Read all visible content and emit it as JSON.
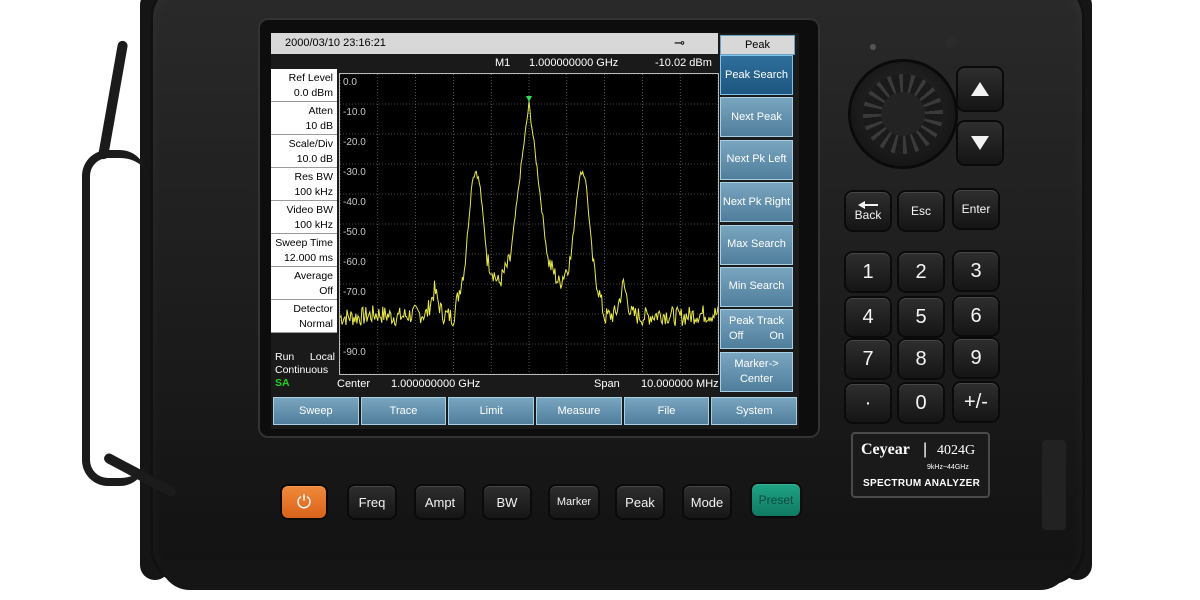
{
  "status_bar": {
    "datetime": "2000/03/10  23:16:21",
    "power_icon": "plug-icon"
  },
  "menu_title": "Peak",
  "marker": {
    "name": "M1",
    "frequency": "1.000000000 GHz",
    "amplitude": "-10.02 dBm"
  },
  "params": [
    {
      "label": "Ref Level",
      "value": "0.0 dBm"
    },
    {
      "label": "Atten",
      "value": "10 dB"
    },
    {
      "label": "Scale/Div",
      "value": "10.0 dB"
    },
    {
      "label": "Res BW",
      "value": "100 kHz"
    },
    {
      "label": "Video BW",
      "value": "100 kHz"
    },
    {
      "label": "Sweep Time",
      "value": "12.000 ms"
    },
    {
      "label": "Average",
      "value": "Off"
    },
    {
      "label": "Detector",
      "value": "Normal"
    }
  ],
  "mode_status": {
    "run": "Run",
    "local": "Local",
    "continuous": "Continuous",
    "mode": "SA"
  },
  "y_ticks": [
    "0.0",
    "-10.0",
    "-20.0",
    "-30.0",
    "-40.0",
    "-50.0",
    "-60.0",
    "-70.0",
    "",
    "-90.0"
  ],
  "footer": {
    "center_label": "Center",
    "center_value": "1.000000000 GHz",
    "span_label": "Span",
    "span_value": "10.000000 MHz"
  },
  "softkeys": {
    "peak_search": "Peak Search",
    "next_peak": "Next Peak",
    "next_pk_left": "Next Pk Left",
    "next_pk_right": "Next Pk Right",
    "max_search": "Max Search",
    "min_search": "Min Search",
    "peak_track": "Peak Track",
    "peak_track_off": "Off",
    "peak_track_on": "On",
    "marker_to": "Marker->",
    "marker_to_center": "Center"
  },
  "bottom_menu": [
    "Sweep",
    "Trace",
    "Limit",
    "Measure",
    "File",
    "System"
  ],
  "hard_keys": {
    "power": "⏻",
    "freq": "Freq",
    "ampt": "Ampt",
    "bw": "BW",
    "marker": "Marker",
    "peak": "Peak",
    "mode": "Mode",
    "preset": "Preset"
  },
  "keypad": {
    "back": "Back",
    "esc": "Esc",
    "enter": "Enter",
    "digits": [
      "1",
      "2",
      "3",
      "4",
      "5",
      "6",
      "7",
      "8",
      "9"
    ],
    "dot": "·",
    "zero": "0",
    "sign": "+/-"
  },
  "brand": {
    "logo": "Ceyear",
    "model": "4024G",
    "range": "9kHz~44GHz",
    "name": "SPECTRUM  ANALYZER"
  },
  "colors": {
    "trace": "#e8e84a",
    "softkey": "#5f8fae",
    "softkey_active": "#2a6a96",
    "power_button": "#e8741f",
    "preset_button": "#17907a",
    "mode_sa": "#1fd11f"
  },
  "chart_data": {
    "type": "line",
    "xlabel": "",
    "ylabel": "",
    "x_unit": "GHz",
    "y_unit": "dBm",
    "xlim": [
      0.995,
      1.005
    ],
    "ylim": [
      -100,
      0
    ],
    "grid": true,
    "series": [
      {
        "values": [
          [
            0.995,
            -81
          ],
          [
            0.9955,
            -81
          ],
          [
            0.996,
            -80
          ],
          [
            0.9965,
            -81
          ],
          [
            0.997,
            -80
          ],
          [
            0.9973,
            -80
          ],
          [
            0.9975,
            -72
          ],
          [
            0.9977,
            -80
          ],
          [
            0.998,
            -81
          ],
          [
            0.9983,
            -64
          ],
          [
            0.9985,
            -35
          ],
          [
            0.9986,
            -32
          ],
          [
            0.9987,
            -37
          ],
          [
            0.9989,
            -62
          ],
          [
            0.9992,
            -70
          ],
          [
            0.9995,
            -62
          ],
          [
            0.9998,
            -30
          ],
          [
            1.0,
            -10
          ],
          [
            1.0002,
            -30
          ],
          [
            1.0005,
            -62
          ],
          [
            1.0008,
            -70
          ],
          [
            1.0011,
            -62
          ],
          [
            1.0013,
            -37
          ],
          [
            1.0014,
            -32
          ],
          [
            1.0015,
            -35
          ],
          [
            1.0017,
            -64
          ],
          [
            1.002,
            -81
          ],
          [
            1.0023,
            -80
          ],
          [
            1.0025,
            -70
          ],
          [
            1.0027,
            -80
          ],
          [
            1.003,
            -81
          ],
          [
            1.0035,
            -80
          ],
          [
            1.004,
            -81
          ],
          [
            1.0045,
            -80
          ],
          [
            1.005,
            -80
          ]
        ]
      }
    ],
    "marker": {
      "x": 1.0,
      "y": -10.02
    }
  }
}
